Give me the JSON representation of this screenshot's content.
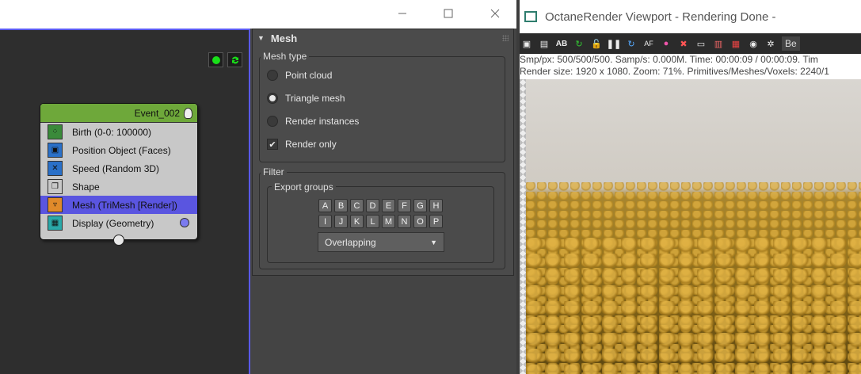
{
  "particle_view": {
    "window_buttons": {
      "minimize": "—",
      "maximize": "☐",
      "close": "✕"
    },
    "event": {
      "title": "Event_002",
      "operators": [
        {
          "label": "Birth (0-0: 100000)",
          "icon": "birth-icon",
          "color": "#3a8a3a"
        },
        {
          "label": "Position Object (Faces)",
          "icon": "position-object-icon",
          "color": "#2a70c8"
        },
        {
          "label": "Speed (Random 3D)",
          "icon": "speed-icon",
          "color": "#2a70c8"
        },
        {
          "label": "Shape",
          "icon": "shape-icon",
          "color": "#c8c8c8"
        },
        {
          "label": "Mesh (TriMesh [Render])",
          "icon": "mesh-icon",
          "color": "#e08a2a",
          "selected": true
        },
        {
          "label": "Display (Geometry)",
          "icon": "display-icon",
          "color": "#2aa8a8"
        }
      ]
    }
  },
  "rollout": {
    "title": "Mesh",
    "mesh_type": {
      "label": "Mesh type",
      "options": [
        {
          "label": "Point cloud",
          "selected": false
        },
        {
          "label": "Triangle mesh",
          "selected": true
        },
        {
          "label": "Render instances",
          "selected": false
        }
      ],
      "render_only": {
        "label": "Render only",
        "checked": true
      }
    },
    "filter": {
      "label": "Filter",
      "export_groups": {
        "label": "Export groups",
        "row1": [
          "A",
          "B",
          "C",
          "D",
          "E",
          "F",
          "G",
          "H"
        ],
        "row2": [
          "I",
          "J",
          "K",
          "L",
          "M",
          "N",
          "O",
          "P"
        ],
        "mode": "Overlapping"
      }
    }
  },
  "viewport": {
    "title": "OctaneRender Viewport - Rendering Done -",
    "toolbar_more": "Be",
    "stats_line1": "Smp/px: 500/500/500.  Samp/s: 0.000M.  Time: 00:00:09 / 00:00:09.  Tim",
    "stats_line2": "Render size: 1920 x 1080.  Zoom: 71%.  Primitives/Meshes/Voxels: 2240/1"
  }
}
